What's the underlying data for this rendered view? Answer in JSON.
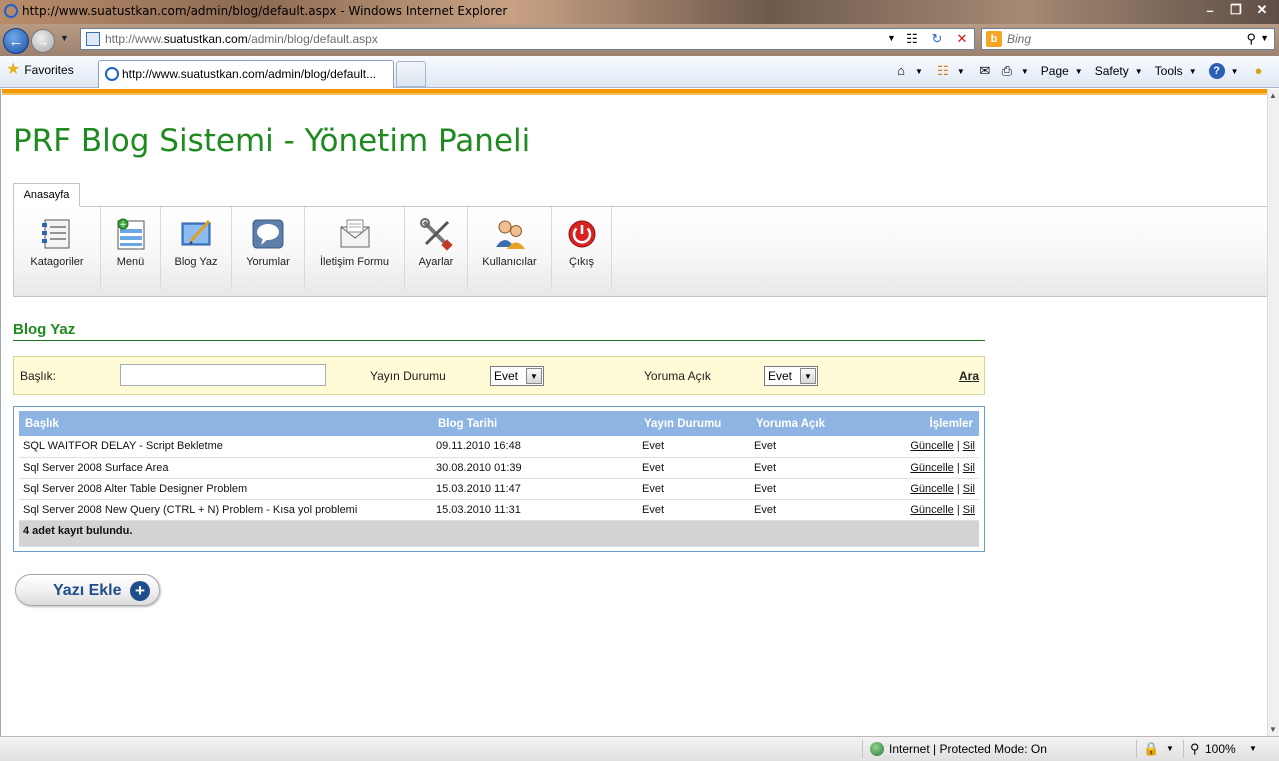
{
  "window": {
    "title": "http://www.suatustkan.com/admin/blog/default.aspx - Windows Internet Explorer"
  },
  "address": {
    "url_prefix": "http://www.",
    "url_domain": "suatustkan.com",
    "url_path": "/admin/blog/default.aspx",
    "search_placeholder": "Bing"
  },
  "commandbar": {
    "favorites_label": "Favorites",
    "tab_label": "http://www.suatustkan.com/admin/blog/default...",
    "page_label": "Page",
    "safety_label": "Safety",
    "tools_label": "Tools"
  },
  "page": {
    "site_title": "PRF Blog Sistemi - Yönetim Paneli",
    "ribbon_tab": "Anasayfa",
    "ribbon_items": [
      {
        "label": "Katagoriler",
        "icon": "categories-icon"
      },
      {
        "label": "Menü",
        "icon": "menu-icon"
      },
      {
        "label": "Blog Yaz",
        "icon": "blog-write-icon"
      },
      {
        "label": "Yorumlar",
        "icon": "comments-icon"
      },
      {
        "label": "İletişim Formu",
        "icon": "contact-form-icon"
      },
      {
        "label": "Ayarlar",
        "icon": "settings-icon"
      },
      {
        "label": "Kullanıcılar",
        "icon": "users-icon"
      },
      {
        "label": "Çıkış",
        "icon": "logout-icon"
      }
    ],
    "section_title": "Blog Yaz",
    "filter": {
      "title_label": "Başlık:",
      "title_value": "",
      "publish_label": "Yayın Durumu",
      "publish_value": "Evet",
      "comment_label": "Yoruma Açık",
      "comment_value": "Evet",
      "search_link": "Ara"
    },
    "grid": {
      "headers": [
        "Başlık",
        "Blog Tarihi",
        "Yayın Durumu",
        "Yoruma Açık",
        "İşlemler"
      ],
      "rows": [
        {
          "title": "SQL WAITFOR DELAY - Script Bekletme",
          "date": "09.11.2010 16:48",
          "published": "Evet",
          "comments": "Evet",
          "edit": "Güncelle",
          "delete": "Sil"
        },
        {
          "title": "Sql Server 2008 Surface Area",
          "date": "30.08.2010 01:39",
          "published": "Evet",
          "comments": "Evet",
          "edit": "Güncelle",
          "delete": "Sil"
        },
        {
          "title": "Sql Server 2008 Alter Table Designer Problem",
          "date": "15.03.2010 11:47",
          "published": "Evet",
          "comments": "Evet",
          "edit": "Güncelle",
          "delete": "Sil"
        },
        {
          "title": "Sql Server 2008 New Query (CTRL + N) Problem - Kısa yol problemi",
          "date": "15.03.2010 11:31",
          "published": "Evet",
          "comments": "Evet",
          "edit": "Güncelle",
          "delete": "Sil"
        }
      ],
      "footer": "4 adet kayıt bulundu."
    },
    "add_button": "Yazı Ekle"
  },
  "statusbar": {
    "zone": "Internet | Protected Mode: On",
    "zoom": "100%"
  },
  "colors": {
    "title_green": "#1f8a1f",
    "orange_accent": "#f29a00",
    "grid_header": "#8db4e2",
    "filter_bg": "#fffbd6"
  }
}
